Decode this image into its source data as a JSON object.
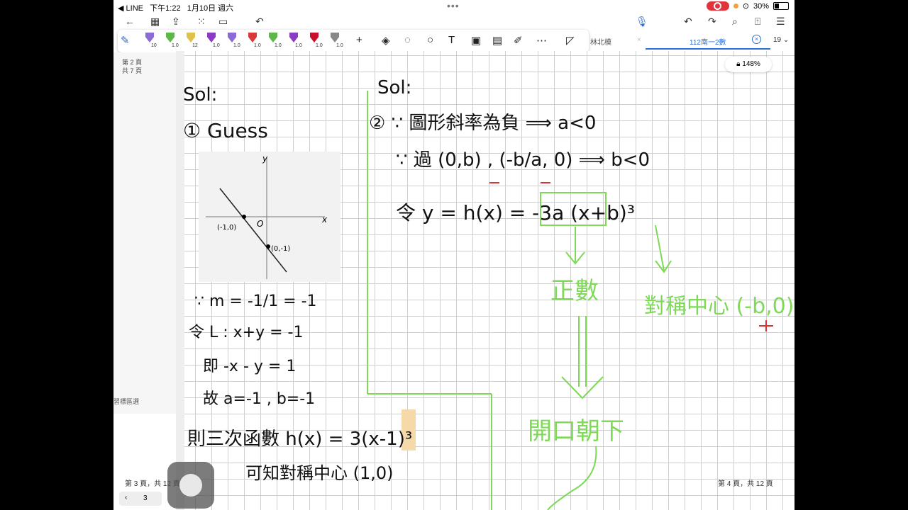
{
  "status": {
    "app": "◀ LINE",
    "time": "下午1:22",
    "date": "1月10日 週六",
    "battery": "30%"
  },
  "toolbar": {
    "back_icon": "chevron-left-icon",
    "undo_icon": "undo-icon",
    "redo_icon": "redo-icon",
    "mic_icon": "mic-icon",
    "search_icon": "search-icon",
    "pen_sizes": [
      "10",
      "1.0",
      "12",
      "1.0",
      "1.0",
      "1.0",
      "1.0",
      "1.0",
      "1.0",
      "1.0"
    ],
    "pen_colors": [
      "#8b6bd6",
      "#5db84a",
      "#e0c24a",
      "#8b3bc4",
      "#8b6bd6",
      "#d83a3a",
      "#5db84a",
      "#8b3bc4",
      "#c8102e",
      "#888888"
    ],
    "add_label": "+"
  },
  "tabs": [
    {
      "label": "林北模",
      "active": false
    },
    {
      "label": "112南一2數",
      "active": true
    }
  ],
  "tab_count": "19",
  "zoom": "148%",
  "left_page": {
    "page_label": "第 2 頁",
    "total_label": "共 7 頁",
    "footer": "第 3 頁，共 12 頁",
    "side_text": "習標區選"
  },
  "page_footer": "第 4 頁，共 12 頁",
  "page_nav": "3",
  "notes": {
    "sol_left": "Sol:",
    "guess": "① Guess",
    "graph_labels": {
      "x": "x",
      "y": "y",
      "o": "O",
      "p1": "(-1,0)",
      "p2": "(0,-1)"
    },
    "left_lines": [
      "∵ m = -1/1 = -1",
      "令 L : x+y = -1",
      "即 -x - y = 1",
      "故 a=-1 , b=-1",
      "則三次函數 h(x) = 3(x-1)³",
      "可知對稱中心 (1,0)"
    ],
    "sol_right": "Sol:",
    "right_lines": [
      "② ∵ 圖形斜率為負 ⟹ a<0",
      "∵ 過 (0,b) , (-b/a, 0) ⟹ b<0",
      "令 y = h(x) = -3a (x+b)³"
    ],
    "green_labels": [
      "正數",
      "對稱中心 (-b,0)",
      "開口朝下"
    ]
  }
}
